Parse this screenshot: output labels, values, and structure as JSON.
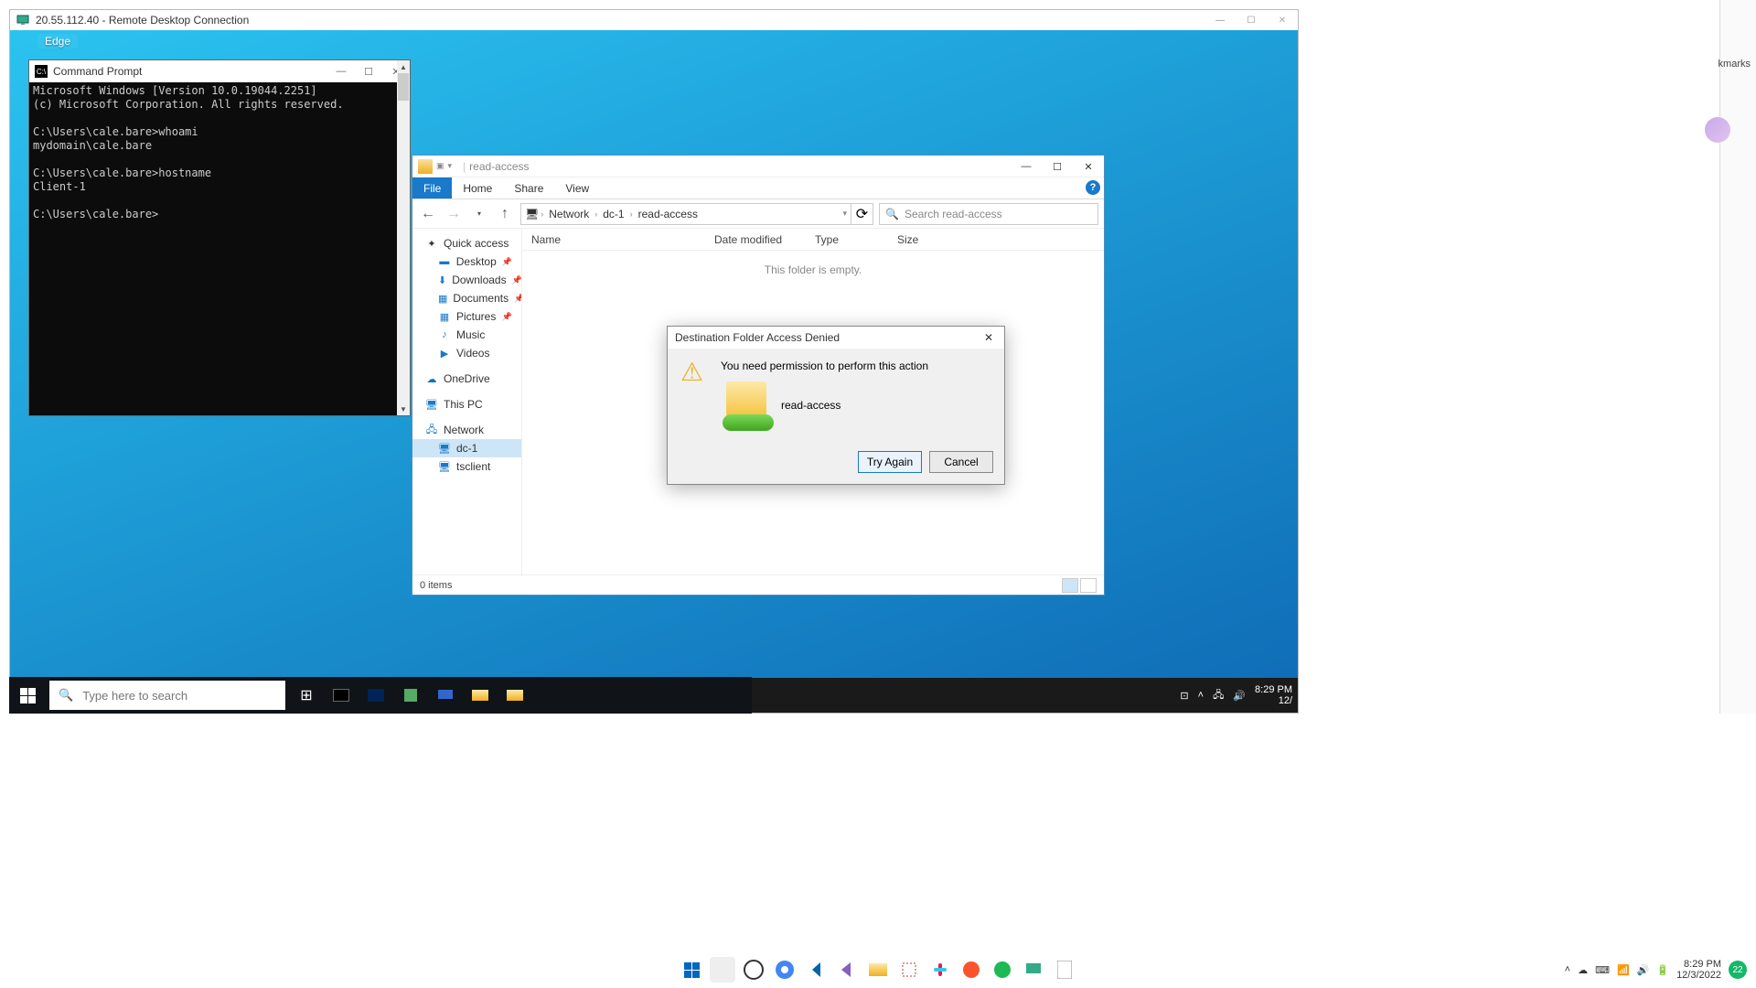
{
  "rdc": {
    "title": "20.55.112.40 - Remote Desktop Connection",
    "min": "—",
    "max": "☐",
    "close": "✕"
  },
  "remote": {
    "edge_label": "Edge"
  },
  "cmd": {
    "title": "Command Prompt",
    "lines": "Microsoft Windows [Version 10.0.19044.2251]\n(c) Microsoft Corporation. All rights reserved.\n\nC:\\Users\\cale.bare>whoami\nmydomain\\cale.bare\n\nC:\\Users\\cale.bare>hostname\nClient-1\n\nC:\\Users\\cale.bare>"
  },
  "explorer": {
    "title": "read-access",
    "ribbon": {
      "file": "File",
      "home": "Home",
      "share": "Share",
      "view": "View"
    },
    "path": {
      "seg1": "Network",
      "seg2": "dc-1",
      "seg3": "read-access"
    },
    "search_placeholder": "Search read-access",
    "cols": {
      "name": "Name",
      "date": "Date modified",
      "type": "Type",
      "size": "Size"
    },
    "empty": "This folder is empty.",
    "status": "0 items",
    "nav": {
      "quick": "Quick access",
      "desktop": "Desktop",
      "downloads": "Downloads",
      "documents": "Documents",
      "pictures": "Pictures",
      "music": "Music",
      "videos": "Videos",
      "onedrive": "OneDrive",
      "thispc": "This PC",
      "network": "Network",
      "dc1": "dc-1",
      "tsclient": "tsclient"
    }
  },
  "dialog": {
    "title": "Destination Folder Access Denied",
    "message": "You need permission to perform this action",
    "folder": "read-access",
    "try_again": "Try Again",
    "cancel": "Cancel"
  },
  "inner_taskbar": {
    "search_placeholder": "Type here to search",
    "time": "8:29 PM",
    "date": "12/"
  },
  "mid_taskbar": {
    "search_placeholder": "Type here to search"
  },
  "host_taskbar": {
    "time": "8:29 PM",
    "date": "12/3/2022",
    "badge": "22"
  },
  "host": {
    "bookmarks": "kmarks"
  }
}
